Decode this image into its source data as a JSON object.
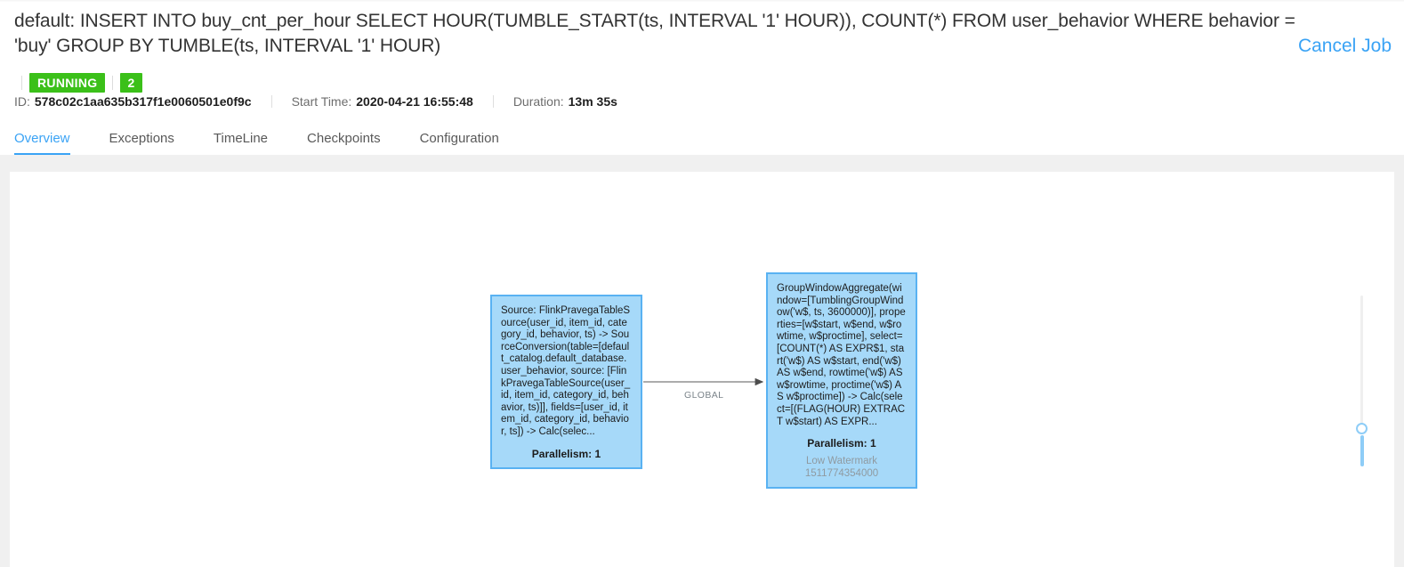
{
  "job": {
    "title": "default: INSERT INTO buy_cnt_per_hour SELECT HOUR(TUMBLE_START(ts, INTERVAL '1' HOUR)), COUNT(*) FROM user_behavior WHERE behavior = 'buy' GROUP BY TUMBLE(ts, INTERVAL '1' HOUR)",
    "cancel_label": "Cancel Job",
    "status_badge": "RUNNING",
    "count_badge": "2",
    "id_label": "ID:",
    "id_value": "578c02c1aa635b317f1e0060501e0f9c",
    "start_time_label": "Start Time:",
    "start_time_value": "2020-04-21 16:55:48",
    "duration_label": "Duration:",
    "duration_value": "13m 35s"
  },
  "tabs": [
    {
      "label": "Overview",
      "active": true
    },
    {
      "label": "Exceptions",
      "active": false
    },
    {
      "label": "TimeLine",
      "active": false
    },
    {
      "label": "Checkpoints",
      "active": false
    },
    {
      "label": "Configuration",
      "active": false
    }
  ],
  "graph": {
    "nodes": [
      {
        "id": "source",
        "description": "Source: FlinkPravegaTableSource(user_id, item_id, category_id, behavior, ts) -> SourceConversion(table=[default_catalog.default_database.user_behavior, source: [FlinkPravegaTableSource(user_id, item_id, category_id, behavior, ts)]], fields=[user_id, item_id, category_id, behavior, ts]) -> Calc(selec...",
        "parallelism": "Parallelism: 1"
      },
      {
        "id": "aggregate",
        "description": "GroupWindowAggregate(window=[TumblingGroupWindow('w$, ts, 3600000)], properties=[w$start, w$end, w$rowtime, w$proctime], select=[COUNT(*) AS EXPR$1, start('w$) AS w$start, end('w$) AS w$end, rowtime('w$) AS w$rowtime, proctime('w$) AS w$proctime]) -> Calc(select=[(FLAG(HOUR) EXTRACT w$start) AS EXPR...",
        "parallelism": "Parallelism: 1",
        "watermark_label": "Low Watermark",
        "watermark_value": "1511774354000"
      }
    ],
    "edge_label": "GLOBAL"
  },
  "colors": {
    "accent": "#3aa3f5",
    "status_green": "#3bc019",
    "node_fill": "#a6d9f9",
    "node_border": "#59b2f2"
  }
}
